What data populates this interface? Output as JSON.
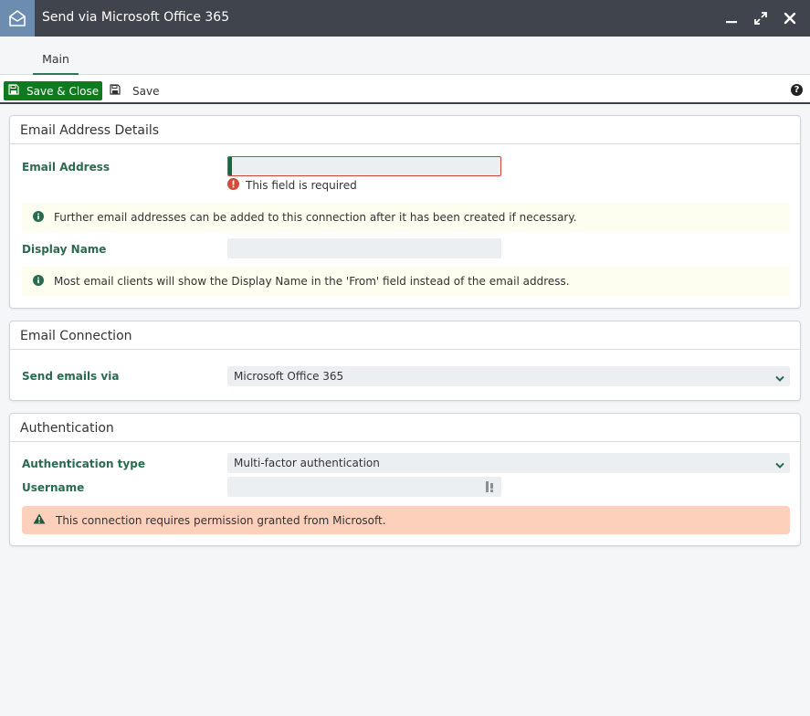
{
  "window": {
    "title": "Send via Microsoft Office 365",
    "accent": "#6c8db0",
    "titlebar_bg": "#40454d",
    "icons": [
      "house-envelope-icon",
      "minimize-icon",
      "maximize-icon",
      "close-icon"
    ]
  },
  "tabs": [
    {
      "label": "Main",
      "active": true
    }
  ],
  "toolbar": {
    "save_close_label": "Save & Close",
    "save_label": "Save",
    "save_close_color": "#0f7a1f"
  },
  "sections": {
    "email_details": {
      "title": "Email Address Details",
      "email_label": "Email Address",
      "email_value": "",
      "email_error": "This field is required",
      "info_1": "Further email addresses can be added to this connection after it has been created if necessary.",
      "display_label": "Display Name",
      "display_value": "",
      "info_2": "Most email clients will show the Display Name in the 'From' field instead of the email address."
    },
    "connection": {
      "title": "Email Connection",
      "send_label": "Send emails via",
      "send_value": "Microsoft Office 365"
    },
    "auth": {
      "title": "Authentication",
      "type_label": "Authentication type",
      "type_value": "Multi-factor authentication",
      "username_label": "Username",
      "username_value": "",
      "warning": "This connection requires permission granted from Microsoft.",
      "warning_bg": "#fdd0bc"
    }
  },
  "colors": {
    "label_green": "#2a6a4f",
    "error_red": "#d24a3a",
    "info_green": "#2a6a4f"
  }
}
